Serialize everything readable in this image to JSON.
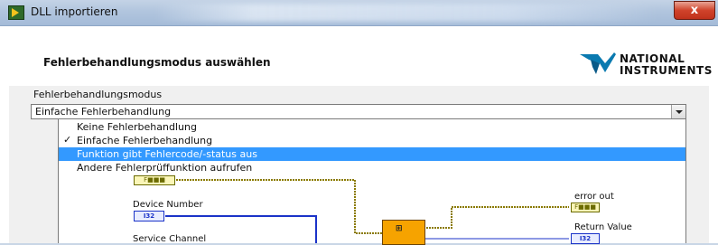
{
  "window": {
    "title": "DLL importieren",
    "close_glyph": "x"
  },
  "header": {
    "title": "Fehlerbehandlungsmodus auswählen",
    "logo": {
      "line1": "NATIONAL",
      "line2": "INSTRUMENTS"
    }
  },
  "mode_select": {
    "label": "Fehlerbehandlungsmodus",
    "value": "Einfache Fehlerbehandlung",
    "options": [
      {
        "label": "Keine Fehlerbehandlung",
        "checked": false,
        "highlighted": false
      },
      {
        "label": "Einfache Fehlerbehandlung",
        "checked": true,
        "highlighted": false
      },
      {
        "label": "Funktion gibt Fehlercode/-status aus",
        "checked": false,
        "highlighted": true
      },
      {
        "label": "Andere Fehlerprüffunktion aufrufen",
        "checked": false,
        "highlighted": false
      }
    ],
    "check_glyph": "✓"
  },
  "diagram": {
    "device_number_label": "Device Number",
    "service_channel_label": "Service Channel",
    "error_out_label": "error out",
    "return_value_label": "Return Value",
    "i32_tag": "I32",
    "error_tag": "F■■■",
    "colors": {
      "i32_wire": "#1b33c8",
      "error_wire": "#8a7a00",
      "node": "#f6a300"
    }
  },
  "icons": [
    "labview-app-icon",
    "close-icon",
    "ni-eagle-logo",
    "dropdown-arrow-icon",
    "check-icon"
  ]
}
